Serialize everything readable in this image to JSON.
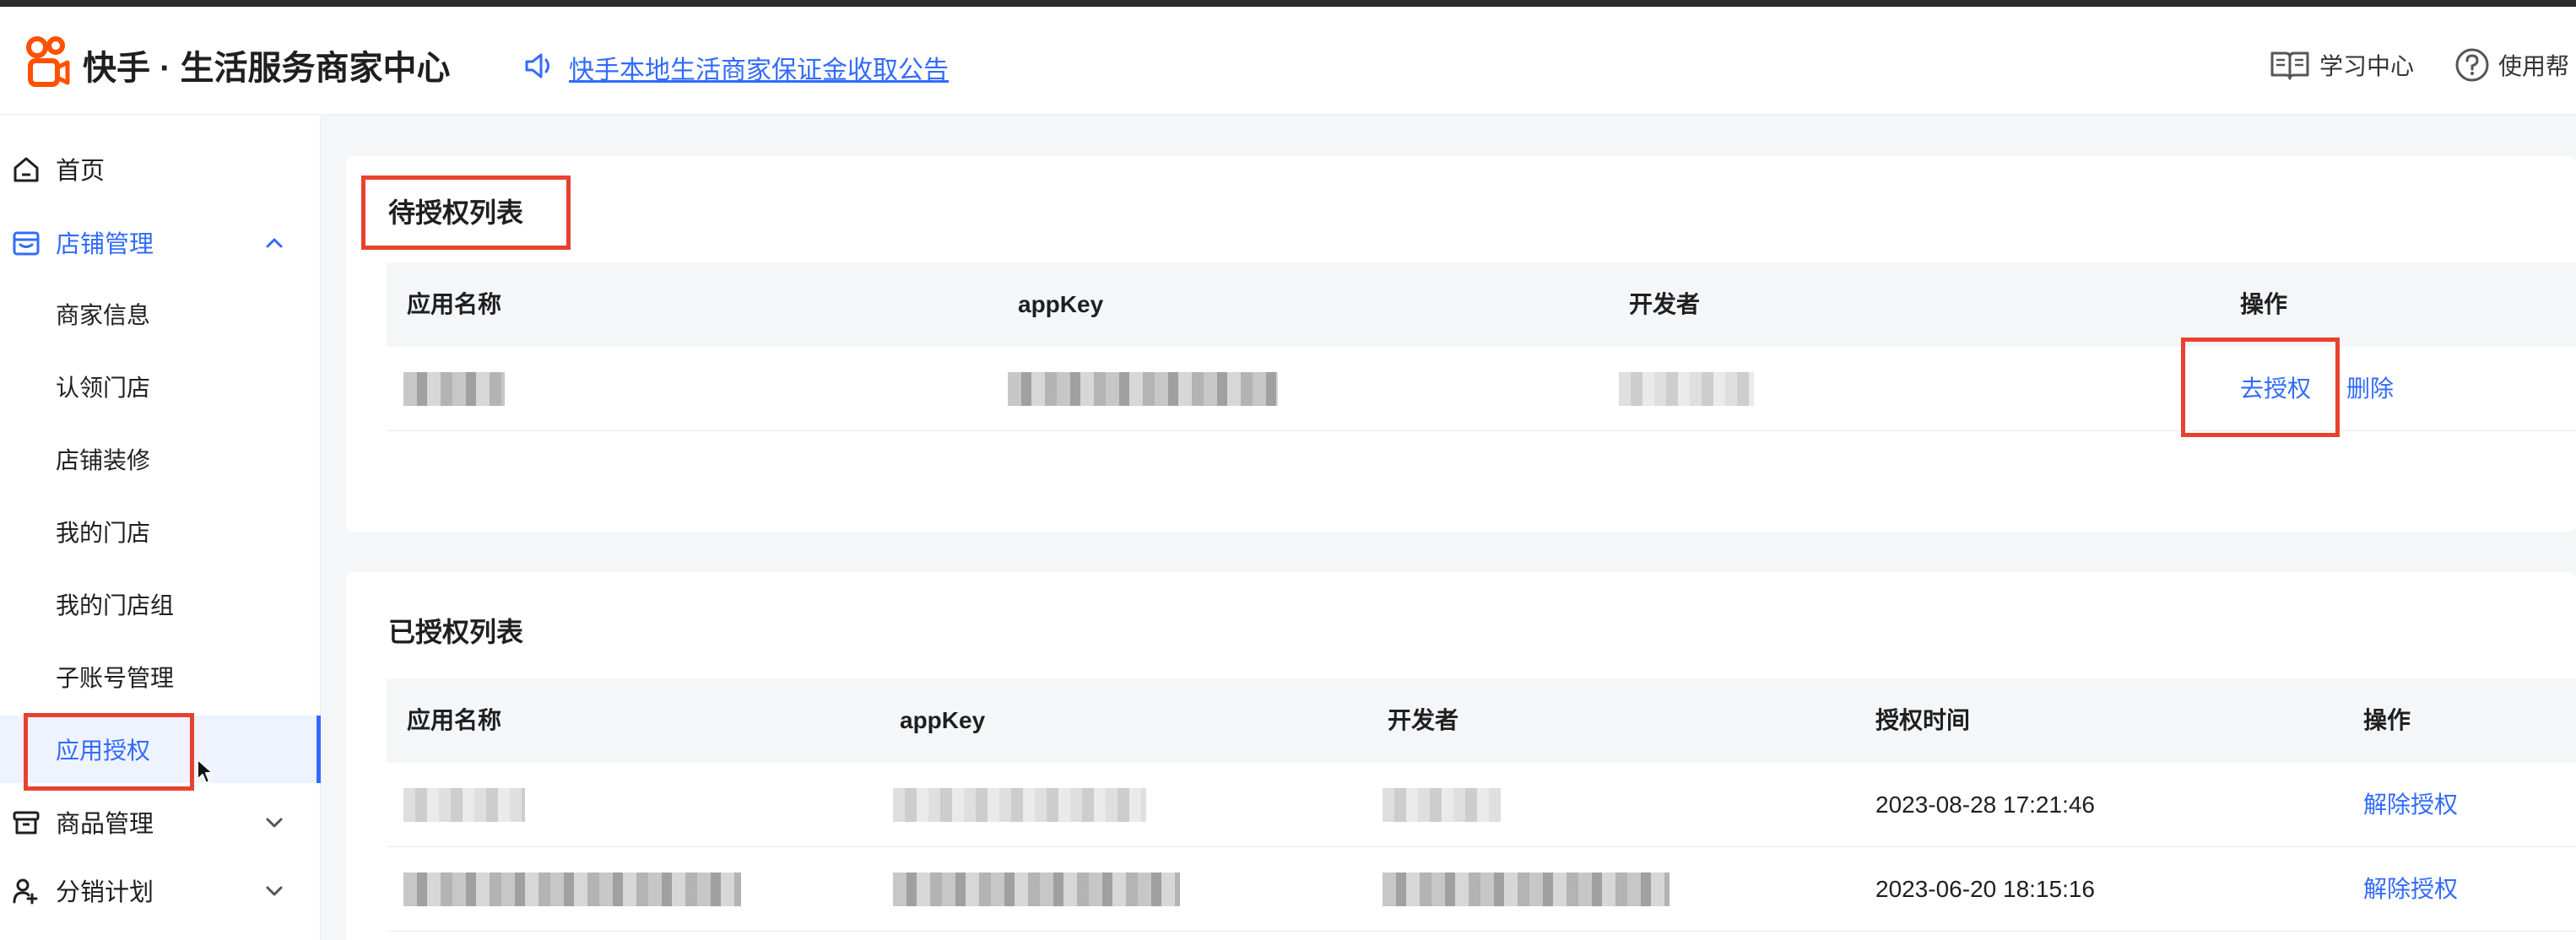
{
  "header": {
    "brand": "快手 · 生活服务商家中心",
    "notice": "快手本地生活商家保证金收取公告",
    "learning_center": "学习中心",
    "help": "使用帮"
  },
  "sidebar": {
    "home": "首页",
    "store_mgmt": "店铺管理",
    "store_sub": [
      "商家信息",
      "认领门店",
      "店铺装修",
      "我的门店",
      "我的门店组",
      "子账号管理",
      "应用授权"
    ],
    "goods_mgmt": "商品管理",
    "distribution": "分销计划"
  },
  "pending": {
    "title": "待授权列表",
    "columns": [
      "应用名称",
      "appKey",
      "开发者",
      "操作"
    ],
    "row_actions": [
      "去授权",
      "删除"
    ]
  },
  "authorized": {
    "title": "已授权列表",
    "columns": [
      "应用名称",
      "appKey",
      "开发者",
      "授权时间",
      "操作"
    ],
    "rows": [
      {
        "time": "2023-08-28 17:21:46",
        "action": "解除授权"
      },
      {
        "time": "2023-06-20 18:15:16",
        "action": "解除授权"
      }
    ]
  },
  "colors": {
    "accent": "#326bfb",
    "highlight_box": "#e8412f",
    "brand_orange": "#ff5000"
  }
}
